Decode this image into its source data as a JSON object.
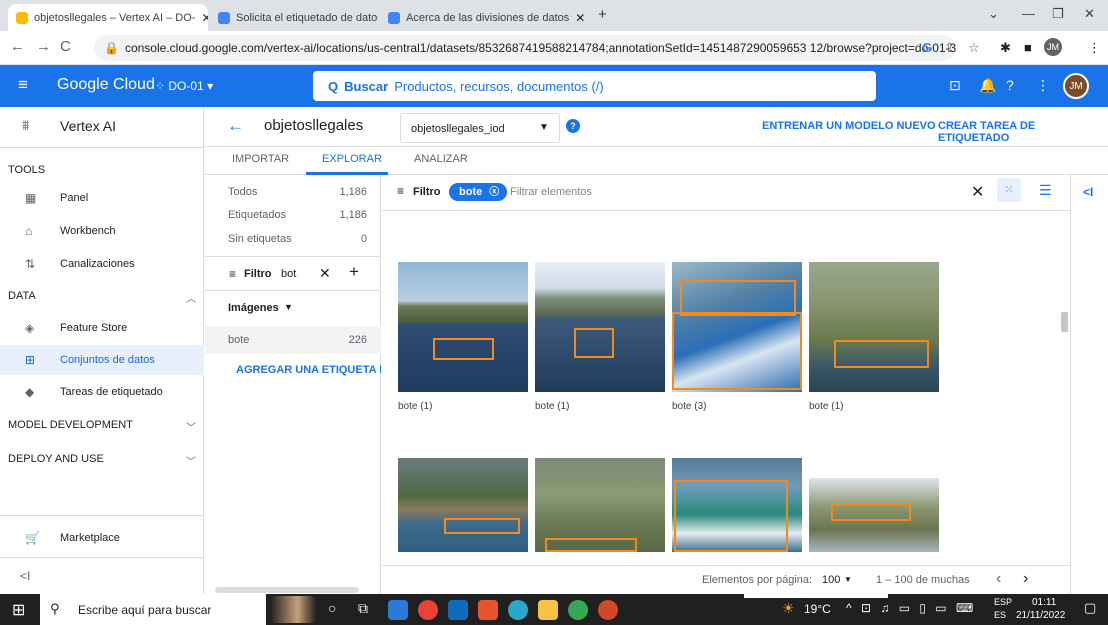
{
  "browser": {
    "tabs": [
      {
        "label": "objetosllegales – Vertex AI – DO-",
        "active": true,
        "fav_color": "#fbbc04"
      },
      {
        "label": "Solicita el etiquetado de datos d",
        "active": false,
        "fav_color": "#4285f4"
      },
      {
        "label": "Acerca de las divisiones de datos",
        "active": false,
        "fav_color": "#4285f4"
      }
    ],
    "new_tab": "+",
    "url": "console.cloud.google.com/vertex-ai/locations/us-central1/datasets/8532687419588214784;annotationSetId=1451487290059653 12/browse?project=do-01-3...",
    "profile": "JM"
  },
  "header": {
    "product": "Google Cloud",
    "project": "DO-01",
    "search_icon": "Q",
    "search_bold": "Buscar",
    "search_placeholder": "Productos, recursos, documentos (/)",
    "avatar": "JM"
  },
  "sidebar": {
    "title": "Vertex AI",
    "sections": [
      {
        "label": "TOOLS"
      },
      {
        "label": "DATA"
      },
      {
        "label": "MODEL DEVELOPMENT"
      },
      {
        "label": "DEPLOY AND USE"
      }
    ],
    "items": [
      {
        "label": "Panel",
        "icon": "dashboard-icon"
      },
      {
        "label": "Workbench",
        "icon": "workbench-icon"
      },
      {
        "label": "Canalizaciones",
        "icon": "pipelines-icon"
      },
      {
        "label": "Feature Store",
        "icon": "feature-store-icon"
      },
      {
        "label": "Conjuntos de datos",
        "icon": "datasets-icon"
      },
      {
        "label": "Tareas de etiquetado",
        "icon": "labeling-icon"
      }
    ],
    "marketplace": "Marketplace",
    "collapse": "<I"
  },
  "titlebar": {
    "back": "←",
    "dataset_name": "objetosllegales",
    "annotation_select": "objetosllegales_iod",
    "train_button": "ENTRENAR UN MODELO NUEVO",
    "label_task_button": "CREAR TAREA DE ETIQUETADO"
  },
  "subtabs": [
    "IMPORTAR",
    "EXPLORAR",
    "ANALIZAR"
  ],
  "labels_panel": {
    "counts": [
      {
        "label": "Todos",
        "value": "1,186"
      },
      {
        "label": "Etiquetados",
        "value": "1,186"
      },
      {
        "label": "Sin etiquetas",
        "value": "0"
      }
    ],
    "filter_label": "Filtro",
    "filter_value": "bot",
    "images_header": "Imágenes",
    "label_rows": [
      {
        "label": "bote",
        "value": "226"
      }
    ],
    "add_label": "AGREGAR UNA ETIQUETA NUE"
  },
  "gallery": {
    "filter_label": "Filtro",
    "chip": "bote",
    "filter_placeholder": "Filtrar elementos",
    "captions": [
      "bote (1)",
      "bote (1)",
      "bote (3)",
      "bote (1)"
    ],
    "pager": {
      "per_page_label": "Elementos por página:",
      "per_page_value": "100",
      "range": "1 – 100 de muchas"
    }
  },
  "taskbar": {
    "search_placeholder": "Escribe aquí para buscar",
    "weather": "19°C",
    "lang_top": "ESP",
    "lang_bottom": "ES",
    "time": "01:11",
    "date": "21/11/2022"
  },
  "colors": {
    "brand_blue": "#1a73e8",
    "bbox_orange": "#f28b1c",
    "selected_bg": "#e8f0fe"
  }
}
